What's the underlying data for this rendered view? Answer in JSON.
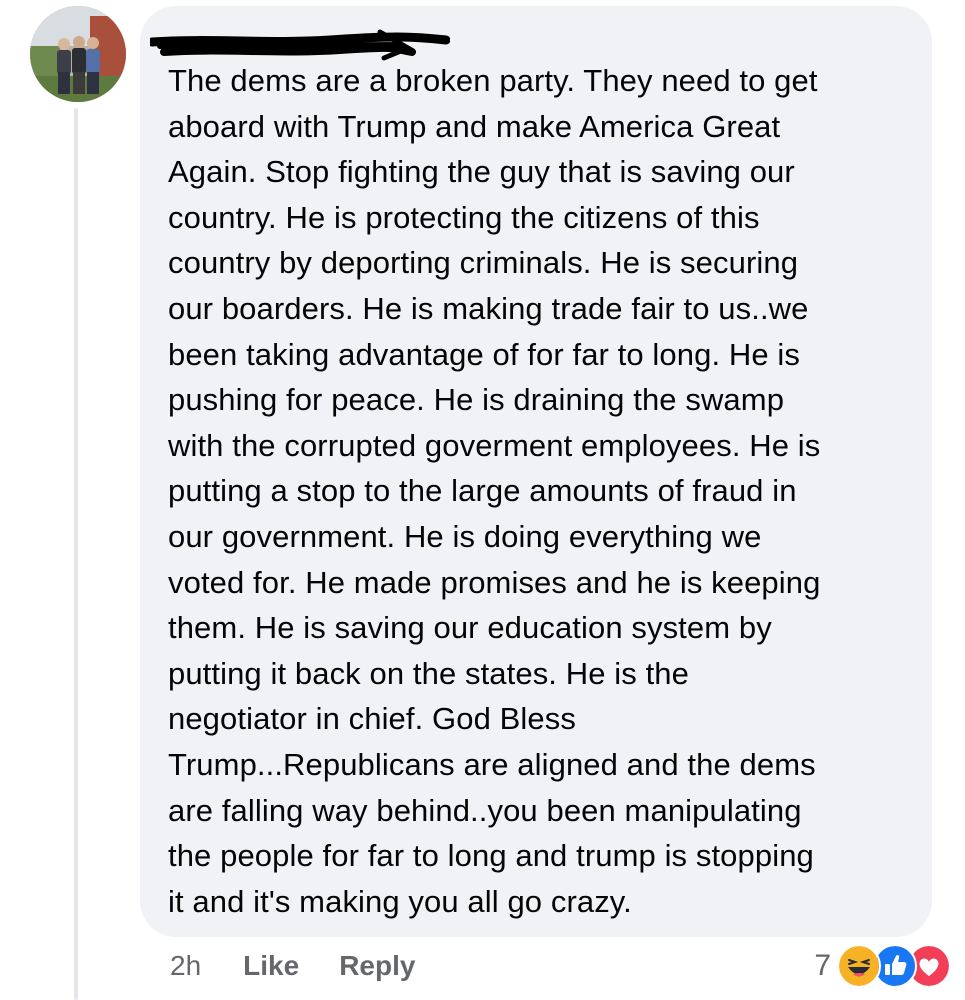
{
  "comment": {
    "author_name_redacted": true,
    "text": "The dems are a broken party. They need to get\naboard with Trump and make America Great\nAgain. Stop fighting the guy that is saving our\ncountry. He is protecting the citizens of this\ncountry by deporting criminals. He is securing\nour boarders. He is making trade fair to us..we\nbeen taking advantage of for far to long. He is\npushing for peace. He is draining the swamp\nwith the corrupted goverment employees. He is\nputting a stop to the large amounts of fraud in\nour government. He is doing everything we\nvoted for. He made promises and he is keeping\nthem. He is saving our education system by\nputting it back on the states. He is the\nnegotiator in chief. God Bless\nTrump...Republicans are aligned and the dems\nare falling way behind..you been manipulating\nthe people for far to long and trump is stopping\nit and it's making you all go crazy."
  },
  "actions": {
    "timestamp": "2h",
    "like_label": "Like",
    "reply_label": "Reply"
  },
  "reactions": {
    "count": "7",
    "icons": [
      "haha-icon",
      "like-icon",
      "love-icon"
    ]
  },
  "colors": {
    "bubble": "#f0f2f5",
    "text": "#050505",
    "secondary_text": "#65676b",
    "like_blue": "#1877f2",
    "love_red": "#f33e58",
    "haha_yellow": "#f7b125"
  }
}
